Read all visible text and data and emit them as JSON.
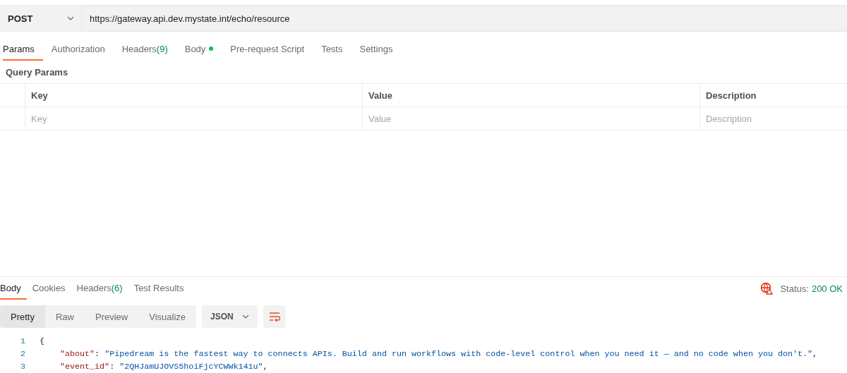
{
  "request": {
    "method": "POST",
    "url": "https://gateway.api.dev.mystate.int/echo/resource"
  },
  "request_tabs": [
    {
      "label": "Params",
      "dot": false,
      "selected": true
    },
    {
      "label": "Authorization",
      "dot": false,
      "selected": false
    },
    {
      "label": "Headers",
      "count": "(9)",
      "dot": false,
      "selected": false
    },
    {
      "label": "Body",
      "dot": true,
      "selected": false
    },
    {
      "label": "Pre-request Script",
      "dot": false,
      "selected": false
    },
    {
      "label": "Tests",
      "dot": false,
      "selected": false
    },
    {
      "label": "Settings",
      "dot": false,
      "selected": false
    }
  ],
  "query_params": {
    "title": "Query Params",
    "columns": [
      "Key",
      "Value",
      "Description"
    ],
    "placeholders": [
      "Key",
      "Value",
      "Description"
    ]
  },
  "response_tabs": [
    {
      "label": "Body",
      "selected": true
    },
    {
      "label": "Cookies",
      "selected": false
    },
    {
      "label": "Headers",
      "count": "(6)",
      "selected": false
    },
    {
      "label": "Test Results",
      "selected": false
    }
  ],
  "status": {
    "label": "Status:",
    "value": "200 OK"
  },
  "view_modes": [
    {
      "label": "Pretty",
      "selected": true
    },
    {
      "label": "Raw",
      "selected": false
    },
    {
      "label": "Preview",
      "selected": false
    },
    {
      "label": "Visualize",
      "selected": false
    }
  ],
  "format": "JSON",
  "code_lines": [
    {
      "number": "1",
      "kind": "brace",
      "text": "{"
    },
    {
      "number": "2",
      "kind": "pair",
      "key": "\"about\"",
      "sep": ": ",
      "value": "\"Pipedream is the fastest way to connects APIs. Build and run workflows with code-level control when you need it — and no code when you don't.\"",
      "end": ","
    },
    {
      "number": "3",
      "kind": "pair",
      "key": "\"event_id\"",
      "sep": ": ",
      "value": "\"2QHJamUJOVS5hoiFjcYCWWk141u\"",
      "end": ","
    }
  ]
}
